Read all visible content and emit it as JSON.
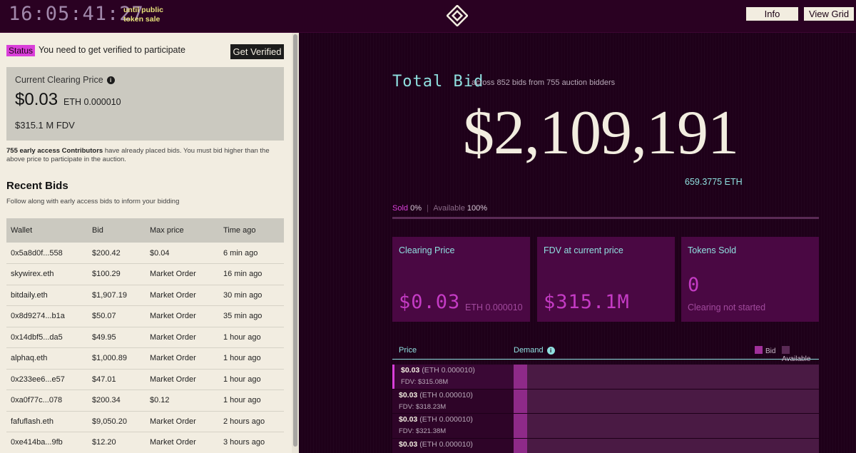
{
  "topbar": {
    "countdown": "16:05:41:27",
    "countdown_label_line1": "until public",
    "countdown_label_line2": "token sale",
    "info_label": "Info",
    "view_grid_label": "View Grid"
  },
  "left": {
    "status_badge": "Status",
    "status_text": "You need to get verified to participate",
    "get_verified_label": "Get Verified",
    "price_box": {
      "label": "Current Clearing Price",
      "price": "$0.03",
      "eth": "ETH 0.000010",
      "fdv": "$315.1 M FDV"
    },
    "early_note_bold": "755 early access Contributors",
    "early_note_rest": " have already placed bids. You must bid higher than the above price to participate in the auction.",
    "recent_title": "Recent Bids",
    "recent_sub": "Follow along with early access bids to inform your bidding",
    "table": {
      "headers": [
        "Wallet",
        "Bid",
        "Max price",
        "Time ago"
      ],
      "rows": [
        [
          "0x5a8d0f...558",
          "$200.42",
          "$0.04",
          "6 min ago"
        ],
        [
          "skywirex.eth",
          "$100.29",
          "Market Order",
          "16 min ago"
        ],
        [
          "bitdaily.eth",
          "$1,907.19",
          "Market Order",
          "30 min ago"
        ],
        [
          "0x8d9274...b1a",
          "$50.07",
          "Market Order",
          "35 min ago"
        ],
        [
          "0x14dbf5...da5",
          "$49.95",
          "Market Order",
          "1 hour ago"
        ],
        [
          "alphaq.eth",
          "$1,000.89",
          "Market Order",
          "1 hour ago"
        ],
        [
          "0x233ee6...e57",
          "$47.01",
          "Market Order",
          "1 hour ago"
        ],
        [
          "0xa0f77c...078",
          "$200.34",
          "$0.12",
          "1 hour ago"
        ],
        [
          "fafuflash.eth",
          "$9,050.20",
          "Market Order",
          "2 hours ago"
        ],
        [
          "0xe414ba...9fb",
          "$12.20",
          "Market Order",
          "3 hours ago"
        ]
      ]
    }
  },
  "right": {
    "total_title": "Total Bid",
    "total_sub": "across 852 bids from 755 auction bidders",
    "total_amount": "$2,109,191",
    "total_eth": "659.3775 ETH",
    "sold_label": "Sold",
    "sold_value": "0%",
    "available_label": "Available",
    "available_value": "100%",
    "sold_fraction": 0,
    "cards": {
      "clearing": {
        "label": "Clearing Price",
        "value": "$0.03",
        "sub": "ETH 0.000010"
      },
      "fdv": {
        "label": "FDV at current price",
        "value": "$315.1M"
      },
      "tokens": {
        "label": "Tokens Sold",
        "value": "0",
        "sub": "Clearing not started"
      }
    },
    "demand": {
      "price_label": "Price",
      "demand_label": "Demand",
      "legend_bid": "Bid",
      "legend_available": "Available",
      "rows": [
        {
          "price": "$0.03",
          "eth": "(ETH 0.000010)",
          "fdv": "FDV: $315.08M",
          "bid_fraction": 0.045
        },
        {
          "price": "$0.03",
          "eth": "(ETH 0.000010)",
          "fdv": "FDV: $318.23M",
          "bid_fraction": 0.045
        },
        {
          "price": "$0.03",
          "eth": "(ETH 0.000010)",
          "fdv": "FDV: $321.38M",
          "bid_fraction": 0.045
        },
        {
          "price": "$0.03",
          "eth": "(ETH 0.000010)",
          "fdv": "",
          "bid_fraction": 0.045
        }
      ]
    },
    "colors": {
      "accent": "#d93fd9",
      "cyan": "#8fe0e0",
      "background": "#1e0019"
    }
  }
}
